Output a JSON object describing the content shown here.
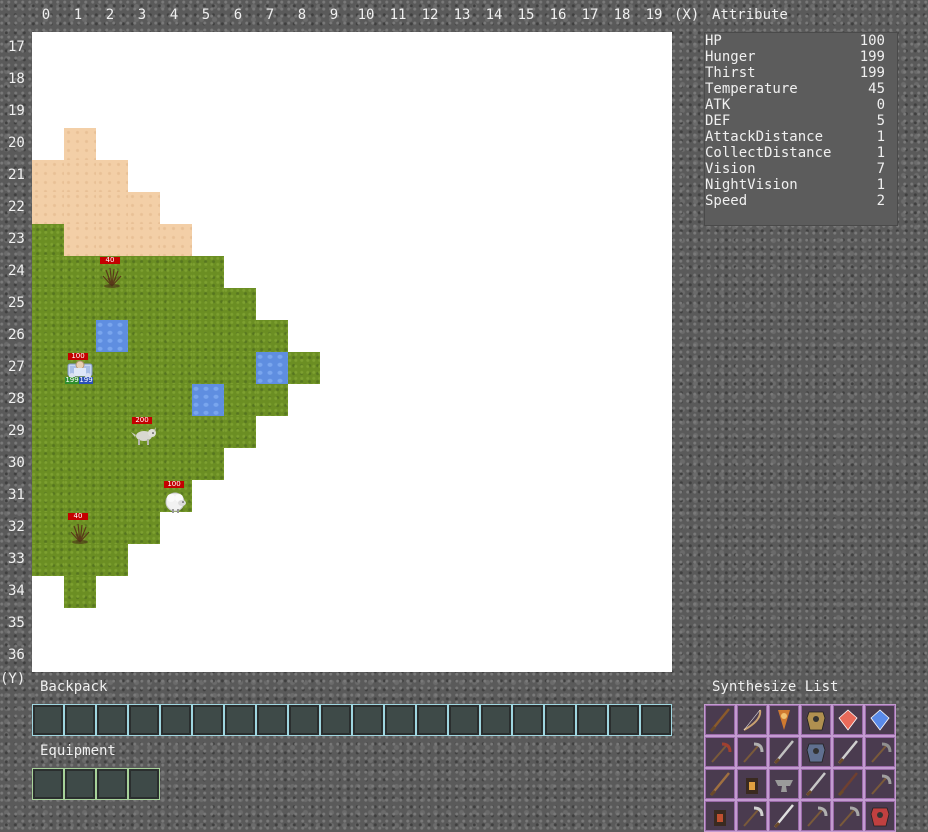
{
  "x_axis": {
    "labels": [
      "0",
      "1",
      "2",
      "3",
      "4",
      "5",
      "6",
      "7",
      "8",
      "9",
      "10",
      "11",
      "12",
      "13",
      "14",
      "15",
      "16",
      "17",
      "18",
      "19",
      "(X)"
    ]
  },
  "y_axis": {
    "labels": [
      "17",
      "18",
      "19",
      "20",
      "21",
      "22",
      "23",
      "24",
      "25",
      "26",
      "27",
      "28",
      "29",
      "30",
      "31",
      "32",
      "33",
      "34",
      "35",
      "36",
      "(Y)"
    ]
  },
  "attribute": {
    "title": "Attribute",
    "rows": [
      {
        "key": "HP",
        "value": "100"
      },
      {
        "key": "Hunger",
        "value": "199"
      },
      {
        "key": "Thirst",
        "value": "199"
      },
      {
        "key": "Temperature",
        "value": "45"
      },
      {
        "key": "ATK",
        "value": "0"
      },
      {
        "key": "DEF",
        "value": "5"
      },
      {
        "key": "AttackDistance",
        "value": "1"
      },
      {
        "key": "CollectDistance",
        "value": "1"
      },
      {
        "key": "Vision",
        "value": "7"
      },
      {
        "key": "NightVision",
        "value": "1"
      },
      {
        "key": "Speed",
        "value": "2"
      }
    ]
  },
  "map": {
    "terrain_rows": [
      {
        "y": 20,
        "tiles": [
          {
            "x": 1,
            "t": "sand"
          }
        ]
      },
      {
        "y": 21,
        "tiles": [
          {
            "x": 0,
            "t": "sand"
          },
          {
            "x": 1,
            "t": "sand"
          },
          {
            "x": 2,
            "t": "sand"
          }
        ]
      },
      {
        "y": 22,
        "tiles": [
          {
            "x": 0,
            "t": "sand"
          },
          {
            "x": 1,
            "t": "sand"
          },
          {
            "x": 2,
            "t": "sand"
          },
          {
            "x": 3,
            "t": "sand"
          }
        ]
      },
      {
        "y": 23,
        "tiles": [
          {
            "x": 0,
            "t": "grass"
          },
          {
            "x": 1,
            "t": "sand"
          },
          {
            "x": 2,
            "t": "sand"
          },
          {
            "x": 3,
            "t": "sand"
          },
          {
            "x": 4,
            "t": "sand"
          }
        ]
      },
      {
        "y": 24,
        "tiles": [
          {
            "x": 0,
            "t": "grass"
          },
          {
            "x": 1,
            "t": "grass"
          },
          {
            "x": 2,
            "t": "grass"
          },
          {
            "x": 3,
            "t": "grass"
          },
          {
            "x": 4,
            "t": "grass"
          },
          {
            "x": 5,
            "t": "grass"
          }
        ]
      },
      {
        "y": 25,
        "tiles": [
          {
            "x": 0,
            "t": "grass"
          },
          {
            "x": 1,
            "t": "grass"
          },
          {
            "x": 2,
            "t": "grass"
          },
          {
            "x": 3,
            "t": "grass"
          },
          {
            "x": 4,
            "t": "grass"
          },
          {
            "x": 5,
            "t": "grass"
          },
          {
            "x": 6,
            "t": "grass"
          }
        ]
      },
      {
        "y": 26,
        "tiles": [
          {
            "x": 0,
            "t": "grass"
          },
          {
            "x": 1,
            "t": "grass"
          },
          {
            "x": 2,
            "t": "water"
          },
          {
            "x": 3,
            "t": "grass"
          },
          {
            "x": 4,
            "t": "grass"
          },
          {
            "x": 5,
            "t": "grass"
          },
          {
            "x": 6,
            "t": "grass"
          },
          {
            "x": 7,
            "t": "grass"
          }
        ]
      },
      {
        "y": 27,
        "tiles": [
          {
            "x": 0,
            "t": "grass"
          },
          {
            "x": 1,
            "t": "grass"
          },
          {
            "x": 2,
            "t": "grass"
          },
          {
            "x": 3,
            "t": "grass"
          },
          {
            "x": 4,
            "t": "grass"
          },
          {
            "x": 5,
            "t": "grass"
          },
          {
            "x": 6,
            "t": "grass"
          },
          {
            "x": 7,
            "t": "water"
          },
          {
            "x": 8,
            "t": "grass"
          }
        ]
      },
      {
        "y": 28,
        "tiles": [
          {
            "x": 0,
            "t": "grass"
          },
          {
            "x": 1,
            "t": "grass"
          },
          {
            "x": 2,
            "t": "grass"
          },
          {
            "x": 3,
            "t": "grass"
          },
          {
            "x": 4,
            "t": "grass"
          },
          {
            "x": 5,
            "t": "water"
          },
          {
            "x": 6,
            "t": "grass"
          },
          {
            "x": 7,
            "t": "grass"
          }
        ]
      },
      {
        "y": 29,
        "tiles": [
          {
            "x": 0,
            "t": "grass"
          },
          {
            "x": 1,
            "t": "grass"
          },
          {
            "x": 2,
            "t": "grass"
          },
          {
            "x": 3,
            "t": "grass"
          },
          {
            "x": 4,
            "t": "grass"
          },
          {
            "x": 5,
            "t": "grass"
          },
          {
            "x": 6,
            "t": "grass"
          }
        ]
      },
      {
        "y": 30,
        "tiles": [
          {
            "x": 0,
            "t": "grass"
          },
          {
            "x": 1,
            "t": "grass"
          },
          {
            "x": 2,
            "t": "grass"
          },
          {
            "x": 3,
            "t": "grass"
          },
          {
            "x": 4,
            "t": "grass"
          },
          {
            "x": 5,
            "t": "grass"
          }
        ]
      },
      {
        "y": 31,
        "tiles": [
          {
            "x": 0,
            "t": "grass"
          },
          {
            "x": 1,
            "t": "grass"
          },
          {
            "x": 2,
            "t": "grass"
          },
          {
            "x": 3,
            "t": "grass"
          },
          {
            "x": 4,
            "t": "grass"
          }
        ]
      },
      {
        "y": 32,
        "tiles": [
          {
            "x": 0,
            "t": "grass"
          },
          {
            "x": 1,
            "t": "grass"
          },
          {
            "x": 2,
            "t": "grass"
          },
          {
            "x": 3,
            "t": "grass"
          }
        ]
      },
      {
        "y": 33,
        "tiles": [
          {
            "x": 0,
            "t": "grass"
          },
          {
            "x": 1,
            "t": "grass"
          },
          {
            "x": 2,
            "t": "grass"
          }
        ]
      },
      {
        "y": 34,
        "tiles": [
          {
            "x": 1,
            "t": "grass"
          }
        ]
      }
    ],
    "entities": [
      {
        "type": "player",
        "x": 1,
        "y": 27,
        "hp": "100",
        "hunger": "199",
        "thirst": "199",
        "icon": "armored-player-icon"
      },
      {
        "type": "bush",
        "x": 2,
        "y": 24,
        "hp": "40",
        "icon": "dry-bush-icon"
      },
      {
        "type": "bush",
        "x": 1,
        "y": 32,
        "hp": "40",
        "icon": "dry-bush-icon"
      },
      {
        "type": "wolf",
        "x": 3,
        "y": 29,
        "hp": "200",
        "icon": "wolf-icon"
      },
      {
        "type": "sheep",
        "x": 4,
        "y": 31,
        "hp": "100",
        "icon": "sheep-icon"
      }
    ]
  },
  "backpack": {
    "title": "Backpack",
    "slot_count": 20
  },
  "equipment": {
    "title": "Equipment",
    "slot_count": 4
  },
  "synthesize": {
    "title": "Synthesize List",
    "items": [
      {
        "icon": "spear-icon",
        "color": "#8b5a2b"
      },
      {
        "icon": "bow-icon",
        "color": "#c8a070"
      },
      {
        "icon": "pendant-icon",
        "color": "#d07a30"
      },
      {
        "icon": "armor-icon",
        "color": "#b09050"
      },
      {
        "icon": "ruby-gem-icon",
        "color": "#e86a5a"
      },
      {
        "icon": "blue-gem-icon",
        "color": "#5a8ae8"
      },
      {
        "icon": "axe-icon",
        "color": "#a04030"
      },
      {
        "icon": "pickaxe-icon",
        "color": "#b0b0b0"
      },
      {
        "icon": "scimitar-icon",
        "color": "#c0c0c0"
      },
      {
        "icon": "dark-armor-icon",
        "color": "#607090"
      },
      {
        "icon": "sword-icon",
        "color": "#d0d0d0"
      },
      {
        "icon": "hook-icon",
        "color": "#909090"
      },
      {
        "icon": "staff-icon",
        "color": "#a07040"
      },
      {
        "icon": "lantern-icon",
        "color": "#e0a040"
      },
      {
        "icon": "anvil-icon",
        "color": "#9a9a9a"
      },
      {
        "icon": "blade-icon",
        "color": "#c8c8c8"
      },
      {
        "icon": "spear-icon",
        "color": "#704030"
      },
      {
        "icon": "hammer-icon",
        "color": "#a0a0a0"
      },
      {
        "icon": "furnace-icon",
        "color": "#c05030"
      },
      {
        "icon": "shovel-icon",
        "color": "#d0d0d0"
      },
      {
        "icon": "lance-icon",
        "color": "#e0e0e0"
      },
      {
        "icon": "scythe-icon",
        "color": "#b0b0b0"
      },
      {
        "icon": "halberd-icon",
        "color": "#a8a8a8"
      },
      {
        "icon": "demon-armor-icon",
        "color": "#c04040"
      }
    ]
  }
}
